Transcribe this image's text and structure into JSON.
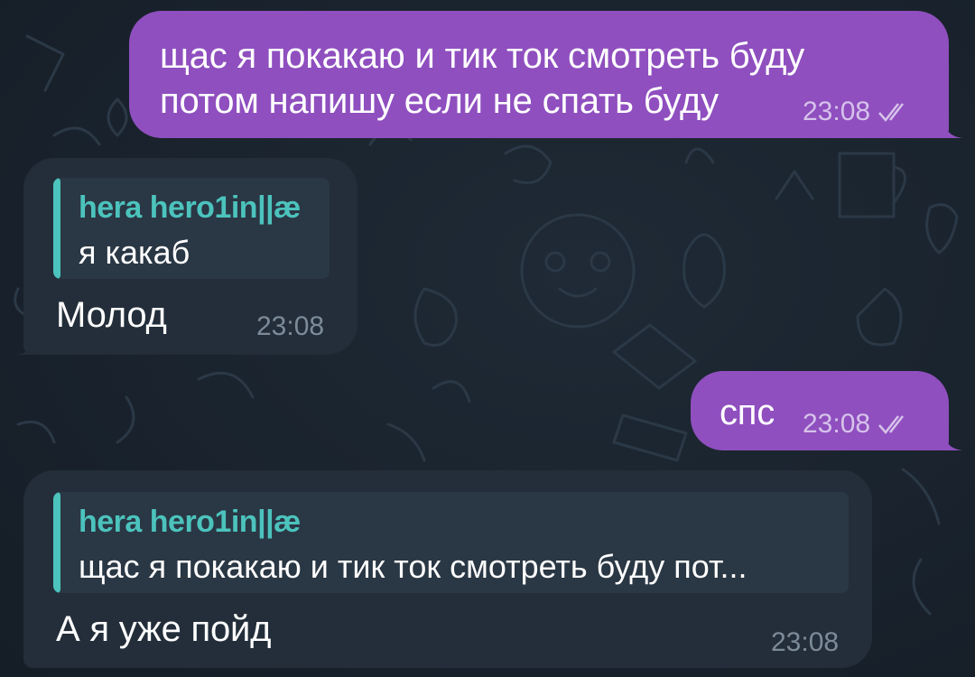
{
  "colors": {
    "background": "#1b2430",
    "outgoing_bubble": "#8f4fbf",
    "incoming_bubble": "#232e3a",
    "reply_accent": "#4cc3bd",
    "reply_background": "#2a3744"
  },
  "messages": [
    {
      "direction": "outgoing",
      "lines": [
        "щас я покакаю и тик ток смотреть буду",
        "потом напишу если не спать буду"
      ],
      "time": "23:08",
      "status_icon": "double-check-icon"
    },
    {
      "direction": "incoming",
      "reply": {
        "author": "hera hero1in||æ",
        "text": "я какаб"
      },
      "text": "Молод",
      "time": "23:08"
    },
    {
      "direction": "outgoing",
      "text": "спс",
      "time": "23:08",
      "status_icon": "double-check-icon"
    },
    {
      "direction": "incoming",
      "reply": {
        "author": "hera hero1in||æ",
        "text": "щас я покакаю и тик ток смотреть буду пот..."
      },
      "text": "А я уже пойд",
      "time": "23:08"
    }
  ]
}
